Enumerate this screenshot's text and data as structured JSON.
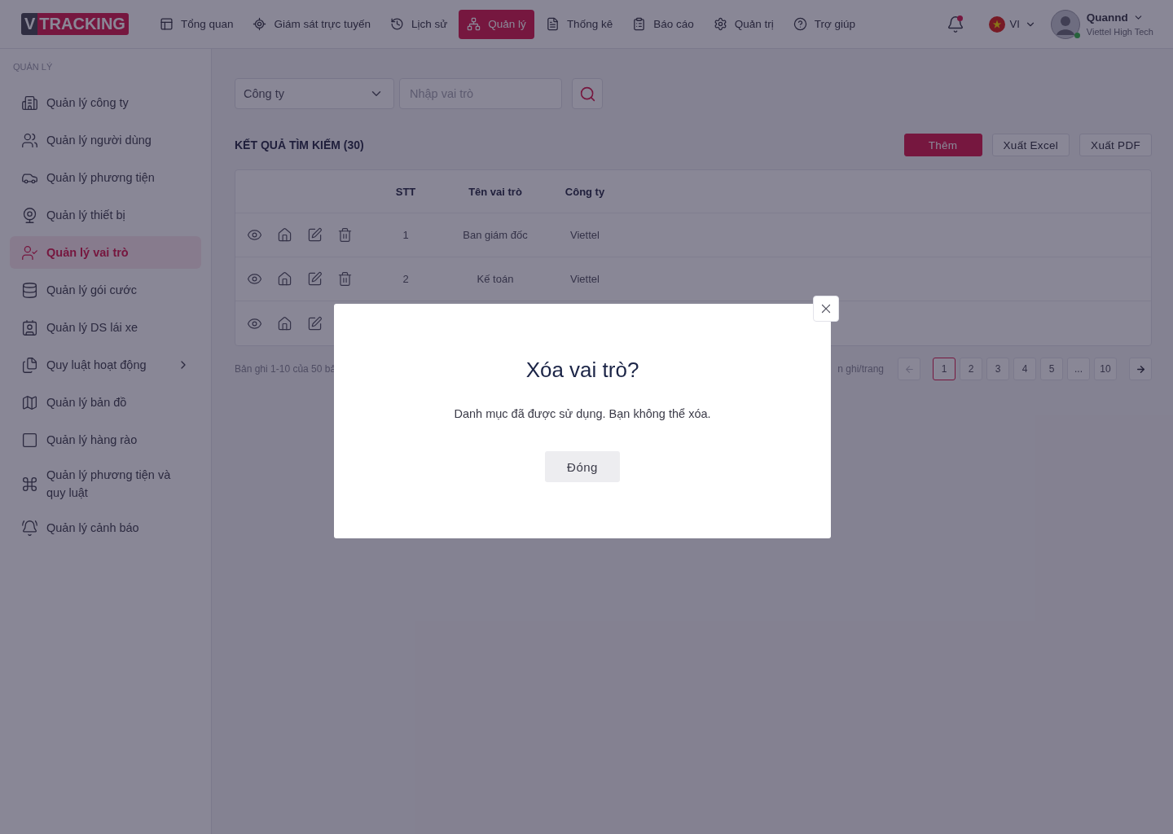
{
  "header": {
    "logo": {
      "mark": "V",
      "text": "TRACKING"
    },
    "nav": [
      {
        "label": "Tổng quan",
        "selected": false
      },
      {
        "label": "Giám sát trực tuyến",
        "selected": false
      },
      {
        "label": "Lịch sử",
        "selected": false
      },
      {
        "label": "Quản lý",
        "selected": true
      },
      {
        "label": "Thống kê",
        "selected": false
      },
      {
        "label": "Báo cáo",
        "selected": false
      },
      {
        "label": "Quản trị",
        "selected": false
      },
      {
        "label": "Trợ giúp",
        "selected": false
      }
    ],
    "notifications": {
      "unread": true
    },
    "language": "VI",
    "user": {
      "name": "Quannd",
      "company": "Viettel High Tech",
      "online": true
    }
  },
  "sidebar": {
    "section": "QUẢN LÝ",
    "items": [
      {
        "label": "Quản lý công ty",
        "selected": false,
        "expandable": false
      },
      {
        "label": "Quản lý người dùng",
        "selected": false,
        "expandable": false
      },
      {
        "label": "Quản lý phương tiện",
        "selected": false,
        "expandable": false
      },
      {
        "label": "Quản lý thiết bị",
        "selected": false,
        "expandable": false
      },
      {
        "label": "Quản lý vai trò",
        "selected": true,
        "expandable": false
      },
      {
        "label": "Quản lý gói cước",
        "selected": false,
        "expandable": false
      },
      {
        "label": "Quản lý DS lái xe",
        "selected": false,
        "expandable": false
      },
      {
        "label": "Quy luật hoạt động",
        "selected": false,
        "expandable": true
      },
      {
        "label": "Quản lý bản đồ",
        "selected": false,
        "expandable": false
      },
      {
        "label": "Quản lý hàng rào",
        "selected": false,
        "expandable": false
      },
      {
        "label": "Quản lý phương tiện và quy luật",
        "selected": false,
        "expandable": false
      },
      {
        "label": "Quản lý cảnh báo",
        "selected": false,
        "expandable": false
      }
    ]
  },
  "filters": {
    "company": {
      "value": "Công ty"
    },
    "role": {
      "placeholder": "Nhập vai trò"
    }
  },
  "results": {
    "title": "KẾT QUẢ TÌM KIẾM (30)",
    "buttons": [
      "Thêm",
      "Xuất Excel",
      "Xuất PDF"
    ]
  },
  "table": {
    "columns": [
      "STT",
      "Tên vai trò",
      "Công ty"
    ],
    "rows": [
      {
        "kind": "role",
        "stt": "1",
        "name": "Ban giám đốc",
        "company": "Viettel"
      },
      {
        "kind": "role",
        "stt": "2",
        "name": "Kế toán",
        "company": "Viettel"
      },
      {
        "kind": "covered"
      }
    ]
  },
  "pagination": {
    "summary": "Bản ghi 1-10 của 50 bả",
    "page_size": "n ghi/trang",
    "pages": [
      {
        "label": "1",
        "selected": true
      },
      {
        "label": "2",
        "selected": false
      },
      {
        "label": "3",
        "selected": false
      },
      {
        "label": "4",
        "selected": false
      },
      {
        "label": "5",
        "selected": false
      },
      {
        "label": "...",
        "selected": false
      },
      {
        "label": "10",
        "selected": false
      }
    ]
  },
  "dialog": {
    "title": "Xóa vai trò?",
    "message": "Danh mục đã được sử dụng. Bạn không thể xóa.",
    "button": "Đóng"
  }
}
